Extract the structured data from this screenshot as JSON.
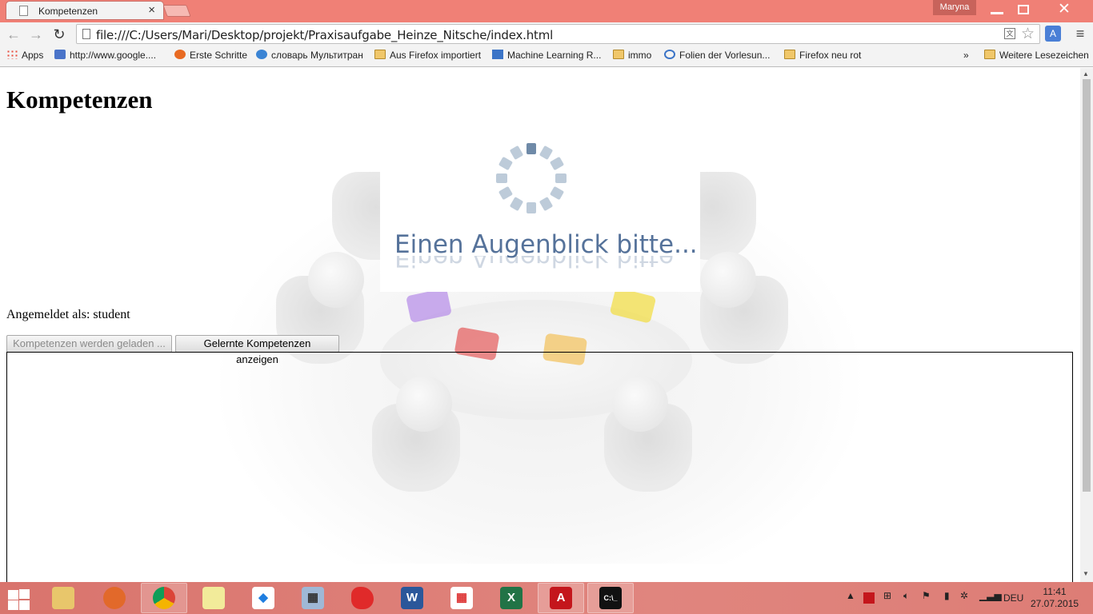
{
  "browser": {
    "tab_title": "Kompetenzen",
    "user_name": "Maryna",
    "url": "file:///C:/Users/Mari/Desktop/projekt/Praxisaufgabe_Heinze_Nitsche/index.html"
  },
  "bookmarks": {
    "items": [
      {
        "label": "Apps",
        "icon": "apps-icon"
      },
      {
        "label": "http://www.google....",
        "icon": "google-icon"
      },
      {
        "label": "Erste Schritte",
        "icon": "firefox-icon"
      },
      {
        "label": "словарь Мультитран",
        "icon": "multitran-icon"
      },
      {
        "label": "Aus Firefox importiert",
        "icon": "folder-icon"
      },
      {
        "label": "Machine Learning R...",
        "icon": "ifi-icon"
      },
      {
        "label": "immo",
        "icon": "folder-icon"
      },
      {
        "label": "Folien der Vorlesun...",
        "icon": "globe-icon"
      },
      {
        "label": "Firefox neu rot",
        "icon": "folder-icon"
      }
    ],
    "overflow": "»",
    "other": "Weitere Lesezeichen"
  },
  "page": {
    "title": "Kompetenzen",
    "loading_text": "Einen Augenblick bitte...",
    "login_label": "Angemeldet als: student",
    "buttons": {
      "loading": "Kompetenzen werden geladen ...",
      "learned": "Gelernte Kompetenzen anzeigen"
    }
  },
  "taskbar": {
    "language": "DEU",
    "time": "11:41",
    "date": "27.07.2015"
  },
  "colors": {
    "titlebar": "#f08076",
    "accent_loading": "#55729a",
    "taskbar": "#e0857e"
  }
}
